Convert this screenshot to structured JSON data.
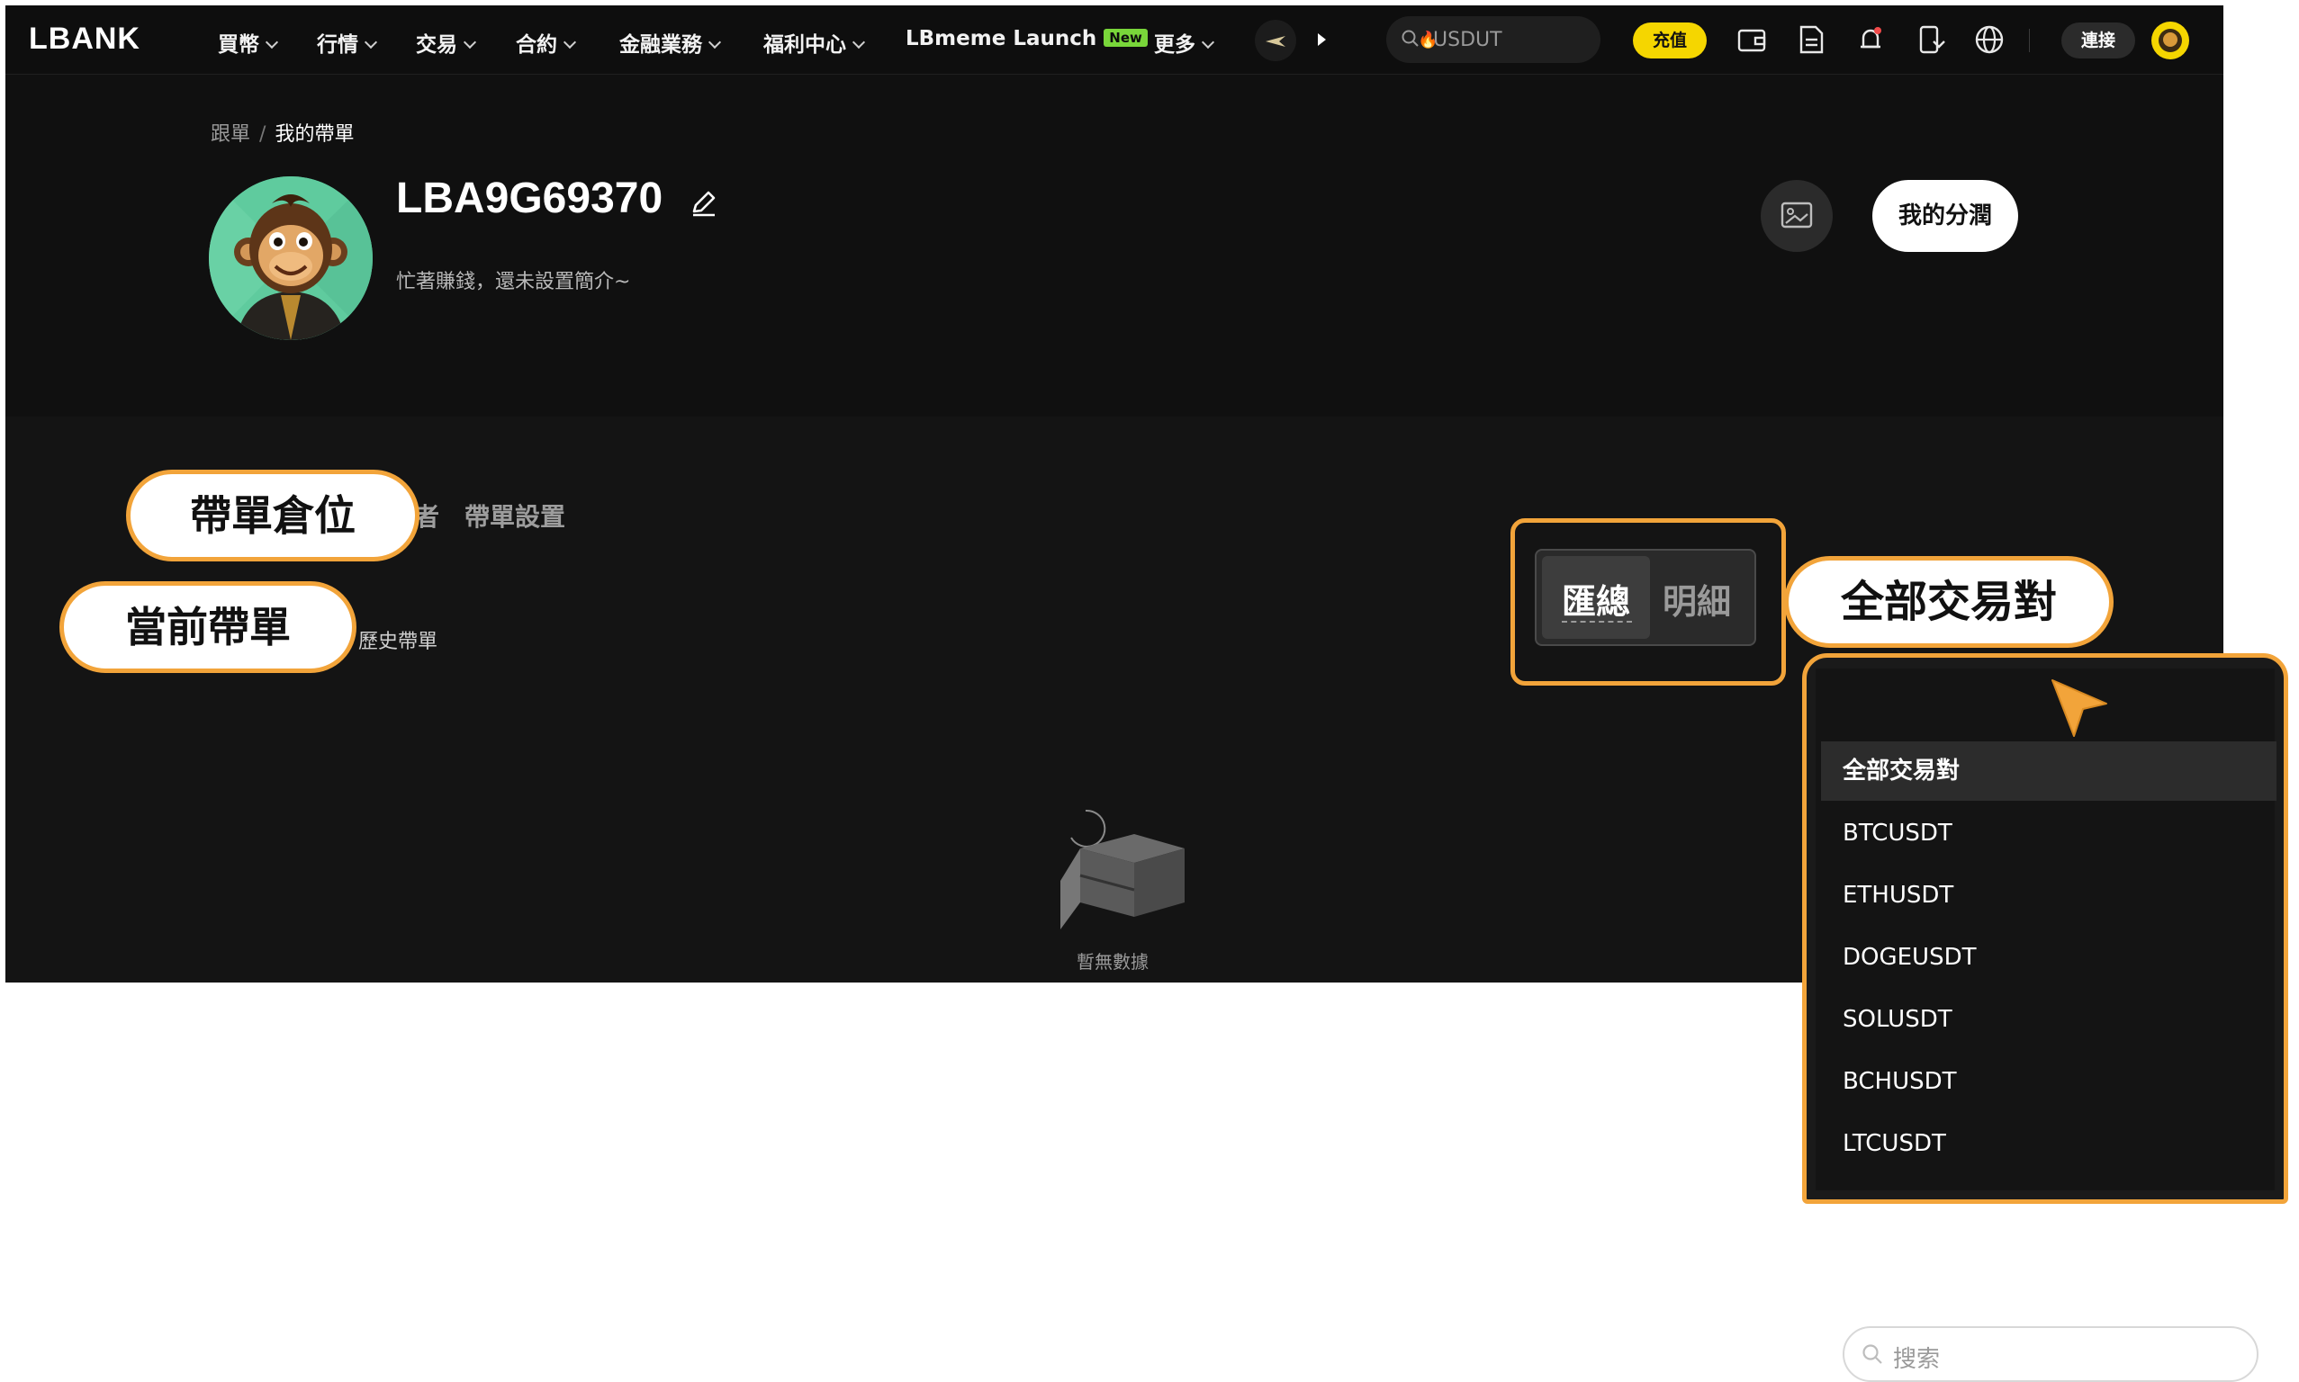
{
  "header": {
    "logo": "LBANK",
    "nav": [
      {
        "label": "買幣",
        "dropdown": true
      },
      {
        "label": "行情",
        "dropdown": true
      },
      {
        "label": "交易",
        "dropdown": true
      },
      {
        "label": "合約",
        "dropdown": true
      },
      {
        "label": "金融業務",
        "dropdown": true
      },
      {
        "label": "福利中心",
        "dropdown": true
      },
      {
        "label": "LBmeme Launch",
        "badge": "New"
      },
      {
        "label": "更多",
        "dropdown": true
      }
    ],
    "search_text": "USDUT",
    "deposit_label": "充值",
    "connect_label": "連接",
    "icons": [
      "plane-icon",
      "play-arrow-icon",
      "wallet-icon",
      "order-document-icon",
      "notification-bell-icon",
      "download-app-icon",
      "globe-icon",
      "user-avatar-icon"
    ]
  },
  "breadcrumb": {
    "parent": "跟單",
    "current": "我的帶單"
  },
  "profile": {
    "username": "LBA9G69370",
    "bio": "忙著賺錢，還未設置簡介~",
    "profit_button": "我的分潤"
  },
  "tabs": {
    "position_tab_partial": "者",
    "settings_tab": "帶單設置"
  },
  "subtabs": {
    "history_tab": "歷史帶單"
  },
  "callouts": {
    "positions": "帶單倉位",
    "current": "當前帶單",
    "all_pairs": "全部交易對"
  },
  "segmented": {
    "summary": "匯總",
    "detail": "明細"
  },
  "empty_state": "暫無數據",
  "dropdown": {
    "search_placeholder": "搜索",
    "items": [
      "全部交易對",
      "BTCUSDT",
      "ETHUSDT",
      "DOGEUSDT",
      "SOLUSDT",
      "BCHUSDT",
      "LTCUSDT"
    ],
    "selected_index": 0
  },
  "colors": {
    "accent_yellow": "#f5d600",
    "callout_border": "#f2a43a",
    "background": "#101010"
  }
}
